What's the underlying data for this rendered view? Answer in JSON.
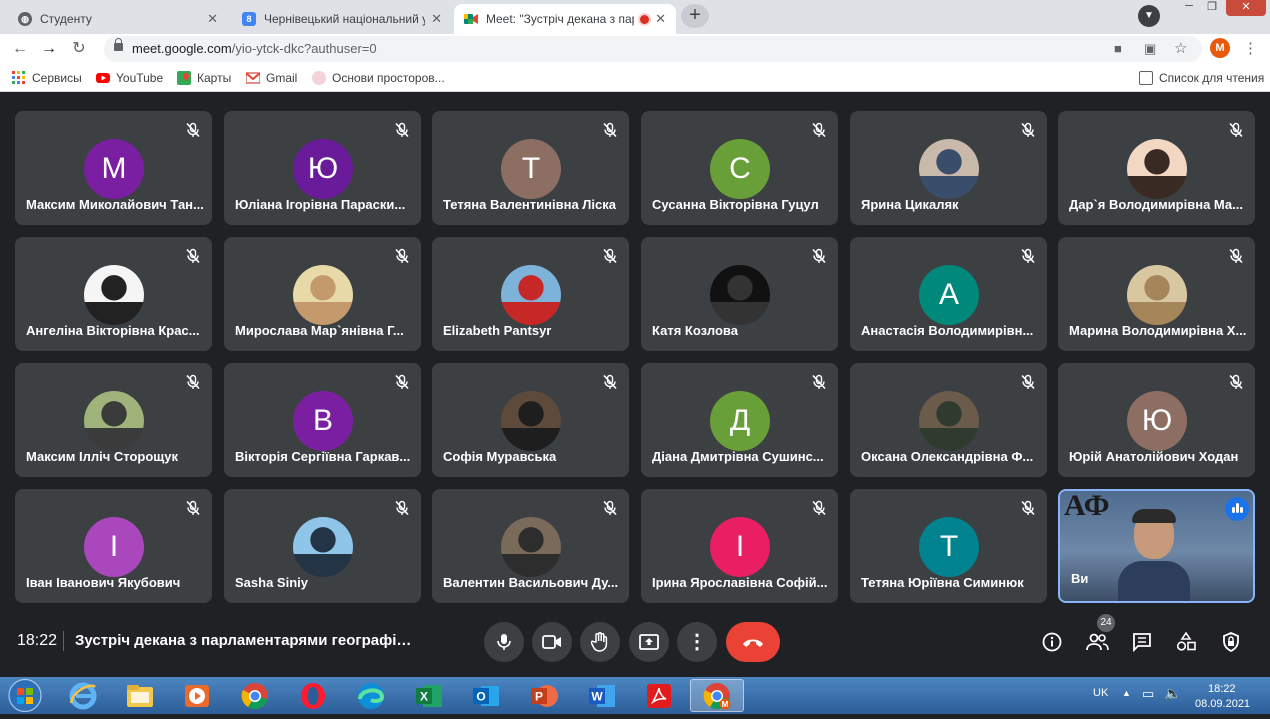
{
  "browser": {
    "tabs": [
      {
        "title": "Студенту",
        "active": false
      },
      {
        "title": "Чернівецький національний ун",
        "active": false
      },
      {
        "title": "Meet: \"Зустріч декана з пар",
        "active": true,
        "recording": true
      }
    ],
    "url_host": "meet.google.com",
    "url_path": "/yio-ytck-dkc?authuser=0",
    "profile_initial": "M",
    "bookmarks": [
      "Сервисы",
      "YouTube",
      "Карты",
      "Gmail",
      "Основи просторов..."
    ],
    "reading_list": "Список для чтения"
  },
  "meet": {
    "participants": [
      {
        "name": "Максим Миколайович Тан...",
        "initial": "М",
        "color": "#7b1fa2"
      },
      {
        "name": "Юліана Ігорівна Параски...",
        "initial": "Ю",
        "color": "#6a1b9a"
      },
      {
        "name": "Тетяна Валентинівна Ліска",
        "initial": "Т",
        "color": "#8d6e63"
      },
      {
        "name": "Сусанна Вікторівна Гуцул",
        "initial": "С",
        "color": "#689f38"
      },
      {
        "name": "Ярина Цикаляк",
        "photo": "photo-icon"
      },
      {
        "name": "Дар`я Володимирівна Ма...",
        "photo": "photo-icon"
      },
      {
        "name": "Ангеліна Вікторівна Крас...",
        "photo": "photo-icon"
      },
      {
        "name": "Мирослава Мар`янівна Г...",
        "photo": "photo-icon"
      },
      {
        "name": "Elizabeth Pantsyr",
        "photo": "photo-icon"
      },
      {
        "name": "Катя Козлова",
        "photo": "photo-icon"
      },
      {
        "name": "Анастасія Володимирівн...",
        "initial": "А",
        "color": "#00897b"
      },
      {
        "name": "Марина Володимирівна Х...",
        "photo": "photo-icon"
      },
      {
        "name": "Максим Ілліч Сторощук",
        "photo": "photo-icon"
      },
      {
        "name": "Вікторія Сергіївна Гаркав...",
        "initial": "В",
        "color": "#7b1fa2"
      },
      {
        "name": "Софія Муравська",
        "photo": "photo-icon"
      },
      {
        "name": "Діана Дмитрівна Сушинс...",
        "initial": "Д",
        "color": "#689f38"
      },
      {
        "name": "Оксана Олександрівна Ф...",
        "photo": "photo-icon"
      },
      {
        "name": "Юрій Анатолійович Ходан",
        "initial": "Ю",
        "color": "#8d6e63"
      },
      {
        "name": "Іван Іванович Якубович",
        "initial": "І",
        "color": "#ab47bc"
      },
      {
        "name": "Sasha Siniy",
        "photo": "photo-icon"
      },
      {
        "name": "Валентин Васильович Ду...",
        "photo": "photo-icon"
      },
      {
        "name": "Ірина Ярославівна Софій...",
        "initial": "І",
        "color": "#e91e63"
      },
      {
        "name": "Тетяна Юріївна Симинюк",
        "initial": "Т",
        "color": "#00838f"
      }
    ],
    "self": {
      "name": "Ви",
      "board_text": "АФ"
    },
    "time": "18:22",
    "meeting_title": "Зустріч декана з парламентарями географічн...",
    "people_count": "24"
  },
  "taskbar": {
    "lang": "UK",
    "time": "18:22",
    "date": "08.09.2021",
    "apps": [
      "ie-icon",
      "explorer-icon",
      "media-player-icon",
      "chrome-icon",
      "opera-icon",
      "edge-icon",
      "excel-icon",
      "outlook-icon",
      "powerpoint-icon",
      "word-icon",
      "acrobat-icon",
      "chrome-active-icon"
    ]
  },
  "colors": {
    "meet_bg": "#202124",
    "tile": "#3c4043",
    "end_call": "#ea4335",
    "accent": "#1a73e8"
  }
}
